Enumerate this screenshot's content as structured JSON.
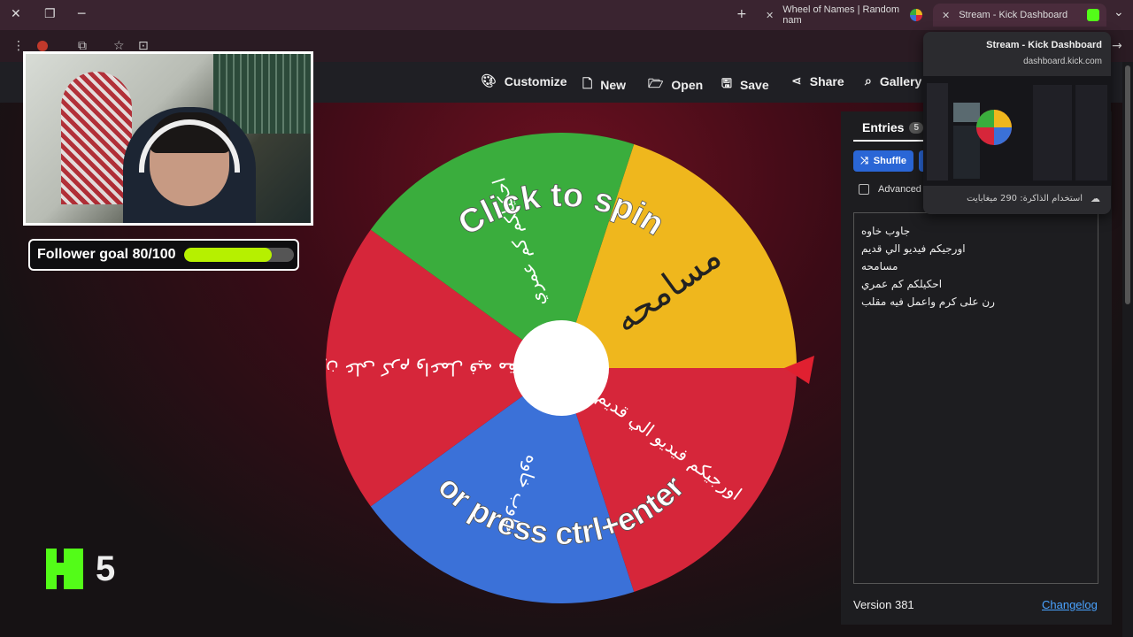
{
  "browser": {
    "tabs": [
      {
        "title": "Wheel of Names | Random nam",
        "active": false
      },
      {
        "title": "Stream - Kick Dashboard",
        "active": true
      }
    ],
    "new_tab_glyph": "+",
    "close_glyph": "✕",
    "menu_glyph": "⌄"
  },
  "tab_preview": {
    "title": "Stream - Kick Dashboard",
    "url": "dashboard.kick.com",
    "memory": "استخدام الذاكرة: 290 ميغابايت"
  },
  "site_nav": {
    "customize": "Customize",
    "new": "New",
    "open": "Open",
    "save": "Save",
    "share": "Share",
    "gallery": "Gallery"
  },
  "overlay": {
    "follower_goal_label": "Follower goal 80/100",
    "follower_goal_progress": 0.8,
    "kick_count": "5",
    "kick_green": "#53fc18"
  },
  "wheel": {
    "prompt_top": "Click to spin",
    "prompt_bottom": "or press ctrl+enter",
    "segments": [
      {
        "label": "مسامحه",
        "color": "#efb71d"
      },
      {
        "label": "اورجيكم فيديو الي قديم",
        "color": "#d6263a"
      },
      {
        "label": "جاوب خاوه",
        "color": "#3b71d8"
      },
      {
        "label": "رن على كرم واعمل فيه مقلب",
        "color": "#d6263a"
      },
      {
        "label": "احكيلكم كم عمري",
        "color": "#3aad3d"
      }
    ]
  },
  "entries_panel": {
    "tab_label": "Entries",
    "count": "5",
    "shuffle_label": "Shuffle",
    "advanced_label": "Advanced",
    "entries": [
      "جاوب خاوه",
      "اورجيكم فيديو الي قديم",
      "مسامحه",
      "احكيلكم كم عمري",
      "رن على كرم واعمل فيه مقلب"
    ],
    "version": "Version 381",
    "changelog": "Changelog"
  }
}
